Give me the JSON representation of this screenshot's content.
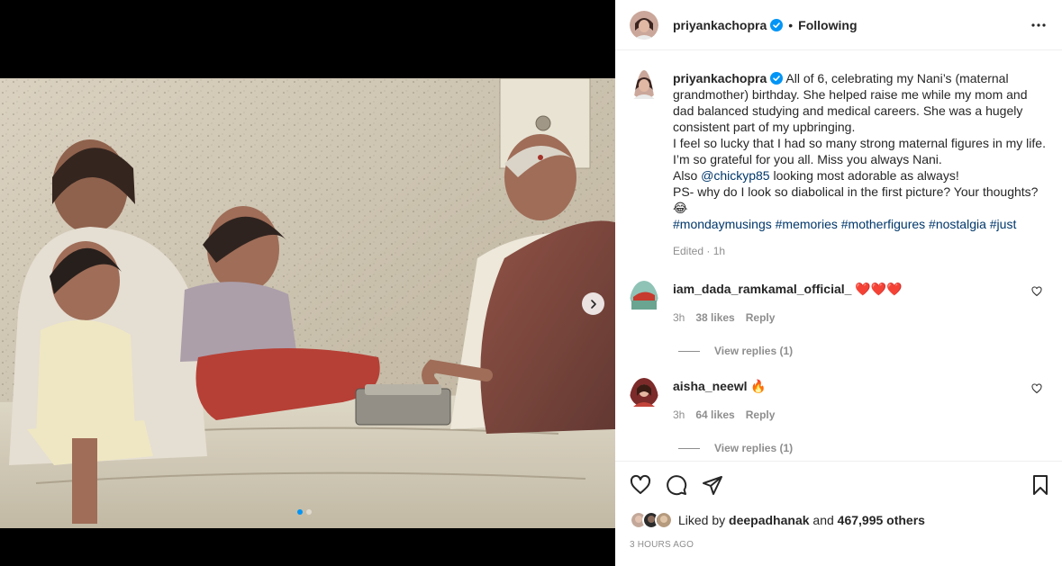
{
  "post": {
    "username": "priyankachopra",
    "follow_status": "Following",
    "separator": "•",
    "more_icon": "more-horizontal-icon",
    "caption_lines": [
      "All of 6, celebrating my Nani’s (maternal grandmother) birthday. She helped raise me while my mom and dad balanced studying and medical careers. She was a hugely consistent part of my upbringing.",
      "I feel so lucky that I had so many strong maternal figures in my life. I’m so grateful for you all. Miss you always Nani."
    ],
    "caption_also_prefix": "Also ",
    "caption_mention": "@chickyp85",
    "caption_also_suffix": " looking most adorable as always!",
    "caption_ps": "PS- why do I look so diabolical in the first picture? Your thoughts? 😂",
    "hashtags": [
      "#mondaymusings",
      "#memories",
      "#motherfigures",
      "#nostalgia",
      "#just"
    ],
    "edited": "Edited · 1h"
  },
  "comments": [
    {
      "username": "iam_dada_ramkamal_official_",
      "text": "❤️❤️❤️",
      "time": "3h",
      "likes": "38 likes",
      "reply": "Reply",
      "view_replies": "View replies (1)"
    },
    {
      "username": "aisha_neewl",
      "text": "🔥",
      "time": "3h",
      "likes": "64 likes",
      "reply": "Reply",
      "view_replies": "View replies (1)"
    }
  ],
  "footer": {
    "liked_by_prefix": "Liked by ",
    "liked_by_user": "deepadhanak",
    "liked_by_and": " and ",
    "liked_by_count": "467,995 others",
    "timestamp": "3 HOURS AGO"
  },
  "colors": {
    "verified": "#0095f6",
    "link": "#00376b",
    "muted": "#8e8e8e",
    "active_dot": "#0095f6",
    "heart_red": "#ed4956"
  },
  "carousel": {
    "total_slides": 2,
    "active_slide": 1
  }
}
